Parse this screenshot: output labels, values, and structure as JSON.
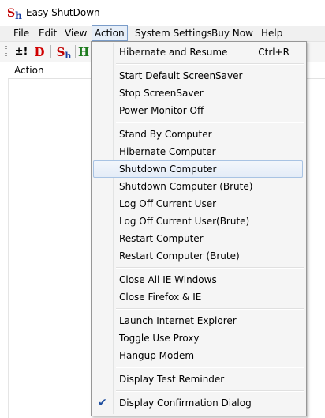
{
  "window": {
    "title": "Easy ShutDown",
    "logo": {
      "s": "S",
      "h": "h"
    }
  },
  "menubar": {
    "items": [
      "File",
      "Edit",
      "View",
      "Action",
      "System Settings",
      "Buy Now",
      "Help"
    ],
    "active": "Action"
  },
  "toolbar": {
    "buttons": [
      {
        "icon": "add-task-icon",
        "glyph": "±!"
      },
      {
        "icon": "d-icon",
        "glyph": "D"
      },
      {
        "icon": "sh-icon",
        "glyph_s": "S",
        "glyph_h": "h"
      },
      {
        "icon": "h-icon",
        "glyph": "H"
      }
    ]
  },
  "list": {
    "header": "Action"
  },
  "action_menu": {
    "items": [
      {
        "label": "Hibernate and Resume",
        "shortcut": "Ctrl+R"
      },
      {
        "label": "Start Default ScreenSaver"
      },
      {
        "label": "Stop ScreenSaver"
      },
      {
        "label": "Power Monitor Off"
      },
      {
        "label": "Stand By Computer"
      },
      {
        "label": "Hibernate Computer"
      },
      {
        "label": "Shutdown Computer"
      },
      {
        "label": "Shutdown Computer (Brute)"
      },
      {
        "label": "Log Off Current User"
      },
      {
        "label": "Log Off Current User(Brute)"
      },
      {
        "label": "Restart Computer"
      },
      {
        "label": "Restart Computer (Brute)"
      },
      {
        "label": "Close All IE Windows"
      },
      {
        "label": "Close Firefox & IE"
      },
      {
        "label": "Launch Internet Explorer"
      },
      {
        "label": "Toggle Use Proxy"
      },
      {
        "label": "Hangup Modem"
      },
      {
        "label": "Display Test Reminder"
      },
      {
        "label": "Display Confirmation Dialog",
        "checked": true
      }
    ],
    "highlighted": "Shutdown Computer",
    "check_glyph": "✔"
  },
  "colors": {
    "menu_hover_border": "#a8c3e3",
    "logo_red": "#c00000",
    "logo_blue": "#1a3fa0"
  }
}
